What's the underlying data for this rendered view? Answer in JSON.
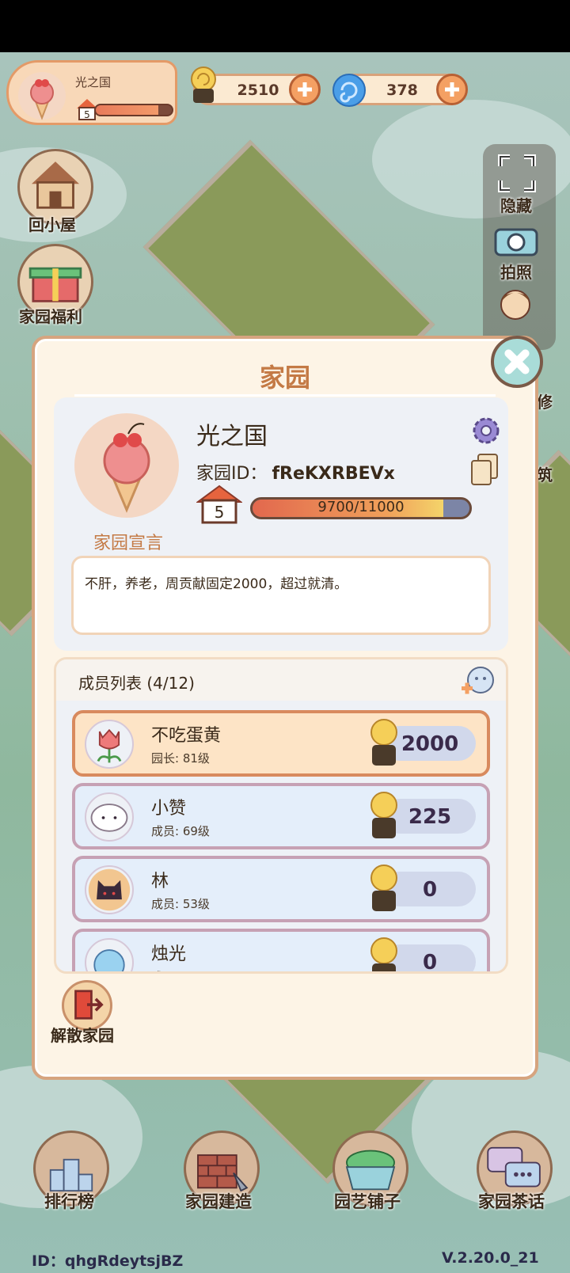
{
  "profile": {
    "name": "光之国",
    "level": "5",
    "level_progress": 0.82
  },
  "currencies": [
    {
      "icon": "snail-coin-icon",
      "value": "2510"
    },
    {
      "icon": "blue-swirl-gem-icon",
      "value": "378"
    }
  ],
  "left_buttons": {
    "home": "回小屋",
    "welfare": "家园福利"
  },
  "side_tools": {
    "hide": "隐藏",
    "photo": "拍照",
    "repair": "修",
    "build": "筑"
  },
  "modal": {
    "title": "家园",
    "garden_name": "光之国",
    "garden_id_label": "家园ID：",
    "garden_id": "fReKXRBEVx",
    "garden_level": "5",
    "progress_text": "9700/11000",
    "progress": 0.88,
    "declaration_label": "家园宣言",
    "declaration": "不肝，养老，周贡献固定2000，超过就清。",
    "members_title": "成员列表 (4/12)",
    "members": [
      {
        "name": "不吃蛋黄",
        "role": "园长",
        "level": "81级",
        "score": "2000",
        "avatar": "tulip-icon"
      },
      {
        "name": "小赞",
        "role": "成员",
        "level": "69级",
        "score": "225",
        "avatar": "sheep-icon"
      },
      {
        "name": "林",
        "role": "成员",
        "level": "53级",
        "score": "0",
        "avatar": "black-cat-icon"
      },
      {
        "name": "烛光",
        "role": "成员",
        "level": "",
        "score": "0",
        "avatar": "blue-bird-icon"
      }
    ],
    "dissolve_label": "解散家园"
  },
  "bottom_nav": {
    "ranking": "排行榜",
    "build": "家园建造",
    "shop": "园艺铺子",
    "chat": "家园茶话"
  },
  "footer": {
    "id_label": "ID",
    "id_value": "qhgRdeytsjBZ",
    "version": "V.2.20.0_21"
  },
  "colors": {
    "accent": "#c47a45",
    "modal_border": "#d6a47f",
    "leader_row": "#fde4c6"
  }
}
